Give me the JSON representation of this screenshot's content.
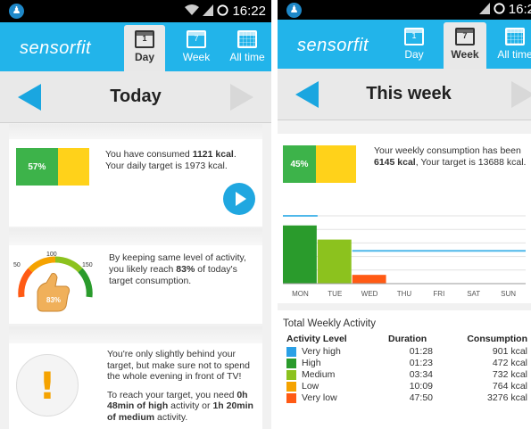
{
  "status": {
    "time": "16:22",
    "time_right": "16:2"
  },
  "app": {
    "brand": "sensorfit"
  },
  "tabs": [
    {
      "label": "Day",
      "cal": "1"
    },
    {
      "label": "Week",
      "cal": "7"
    },
    {
      "label": "All time",
      "cal": ""
    }
  ],
  "day": {
    "title": "Today",
    "consumption": {
      "percent": "57%",
      "percent_value": 57,
      "text_pre": "You have consumed ",
      "kcal": "1121 kcal",
      "text_post": ".",
      "target_line": "Your daily target is 1973 kcal."
    },
    "gauge": {
      "tick_50": "50",
      "tick_100": "100",
      "tick_150": "150",
      "value": "83%",
      "text_pre": "By keeping same level of activity, you likely reach ",
      "percent": "83%",
      "text_post": " of today's target consumption."
    },
    "advice": {
      "line1": "You're only slightly behind your target, but make sure not to spend the whole evening in front of TV!",
      "p2_pre": "To reach your target, you need ",
      "p2_b1": "0h 48min of high",
      "p2_mid": " activity or ",
      "p2_b2": "1h 20min of medium",
      "p2_post": " activity."
    }
  },
  "week": {
    "title": "This week",
    "consumption": {
      "percent": "45%",
      "percent_value": 45,
      "text_pre": "Your weekly consumption has been ",
      "kcal": "6145 kcal",
      "text_post": ", Your target is 13688 kcal."
    },
    "chart_data": {
      "type": "bar",
      "categories": [
        "MON",
        "TUE",
        "WED",
        "THU",
        "FRI",
        "SAT",
        "SUN"
      ],
      "values": [
        2060,
        1560,
        310,
        0,
        0,
        0,
        0
      ],
      "colors": [
        "#2a9b2c",
        "#8cc21e",
        "#ff5a14",
        "#cccccc",
        "#cccccc",
        "#cccccc",
        "#cccccc"
      ],
      "ylim": [
        0,
        2400
      ],
      "reference_lines": [
        2400,
        1160
      ],
      "grid": true,
      "title": "",
      "xlabel": "",
      "ylabel": ""
    },
    "total_title": "Total Weekly Activity",
    "table_headers": {
      "level": "Activity Level",
      "duration": "Duration",
      "consumption": "Consumption"
    },
    "rows": [
      {
        "level": "Very high",
        "duration": "01:28",
        "consumption": "901 kcal",
        "color": "#2aa0e6"
      },
      {
        "level": "High",
        "duration": "01:23",
        "consumption": "472 kcal",
        "color": "#2a9b2c"
      },
      {
        "level": "Medium",
        "duration": "03:34",
        "consumption": "732 kcal",
        "color": "#8cc21e"
      },
      {
        "level": "Low",
        "duration": "10:09",
        "consumption": "764 kcal",
        "color": "#f5a300"
      },
      {
        "level": "Very low",
        "duration": "47:50",
        "consumption": "3276 kcal",
        "color": "#ff5a14"
      }
    ]
  },
  "colors": {
    "accent": "#22b4ea",
    "used": "#3db34a",
    "remaining": "#ffd21a",
    "warning": "#f5a300"
  },
  "icons": [
    "app-icon",
    "wifi-icon",
    "signal-icon",
    "alarm-icon",
    "calendar-icon",
    "prev-arrow-icon",
    "next-arrow-icon",
    "play-icon",
    "thumbs-up-icon",
    "exclamation-icon"
  ]
}
